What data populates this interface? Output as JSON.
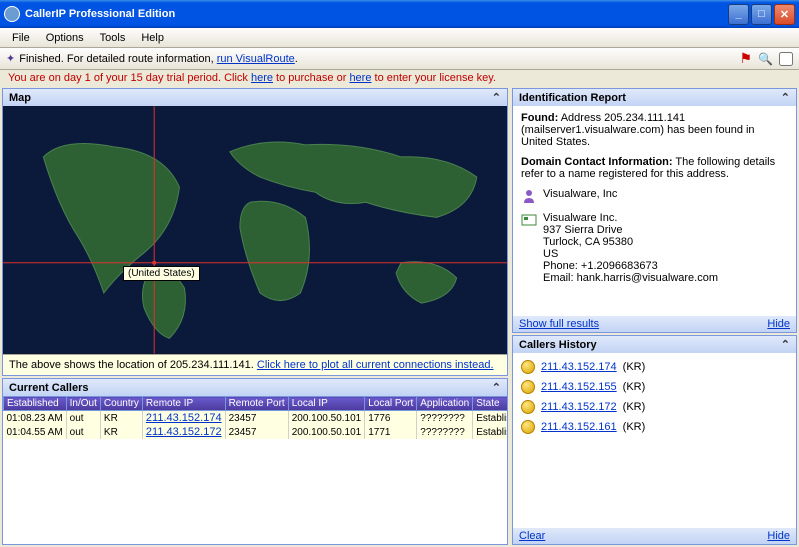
{
  "window": {
    "title": "CallerIP Professional Edition"
  },
  "menu": {
    "file": "File",
    "options": "Options",
    "tools": "Tools",
    "help": "Help"
  },
  "toolbar": {
    "status_prefix": "Finished. For detailed route information, ",
    "status_link": "run VisualRoute",
    "status_suffix": "."
  },
  "trial": {
    "p1": "You are on day 1 of your 15 day trial period. Click ",
    "l1": "here",
    "p2": " to purchase or ",
    "l2": "here",
    "p3": " to enter your license key."
  },
  "map": {
    "title": "Map",
    "tooltip": "(United States)",
    "footer_prefix": "The above shows the location of 205.234.111.141. ",
    "footer_link": "Click here to plot all current connections instead."
  },
  "callers": {
    "title": "Current Callers",
    "cols": {
      "c0": "Established",
      "c1": "In/Out",
      "c2": "Country",
      "c3": "Remote IP",
      "c4": "Remote Port",
      "c5": "Local IP",
      "c6": "Local Port",
      "c7": "Application",
      "c8": "State"
    },
    "rows": [
      {
        "est": "01:08.23 AM",
        "io": "out",
        "cc": "KR",
        "rip": "211.43.152.174",
        "rport": "23457",
        "lip": "200.100.50.101",
        "lport": "1776",
        "app": "????????",
        "state": "Established"
      },
      {
        "est": "01:04.55 AM",
        "io": "out",
        "cc": "KR",
        "rip": "211.43.152.172",
        "rport": "23457",
        "lip": "200.100.50.101",
        "lport": "1771",
        "app": "????????",
        "state": "Established"
      }
    ]
  },
  "idreport": {
    "title": "Identification Report",
    "found_label": "Found:",
    "found_text": " Address 205.234.111.141 (mailserver1.visualware.com) has been found in United States.",
    "dci_label": "Domain Contact Information:",
    "dci_text": " The following details refer to a name registered for this address.",
    "org": "Visualware, Inc",
    "addr": {
      "name": "Visualware Inc.",
      "street": "937 Sierra Drive",
      "city": "Turlock, CA 95380",
      "country": "US",
      "phone": "Phone: +1.2096683673",
      "email": "Email: hank.harris@visualware.com"
    },
    "footer_left": "Show full results",
    "footer_right": "Hide"
  },
  "history": {
    "title": "Callers History",
    "items": [
      {
        "ip": "211.43.152.174",
        "cc": "(KR)"
      },
      {
        "ip": "211.43.152.155",
        "cc": "(KR)"
      },
      {
        "ip": "211.43.152.172",
        "cc": "(KR)"
      },
      {
        "ip": "211.43.152.161",
        "cc": "(KR)"
      }
    ],
    "footer_left": "Clear",
    "footer_right": "Hide"
  }
}
